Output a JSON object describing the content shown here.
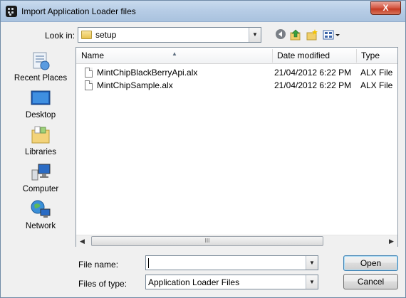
{
  "window": {
    "title": "Import Application Loader files",
    "close_label": "X"
  },
  "lookin": {
    "label": "Look in:",
    "value": "setup"
  },
  "places": [
    {
      "label": "Recent Places",
      "icon": "recent-places-icon"
    },
    {
      "label": "Desktop",
      "icon": "desktop-icon"
    },
    {
      "label": "Libraries",
      "icon": "libraries-icon"
    },
    {
      "label": "Computer",
      "icon": "computer-icon"
    },
    {
      "label": "Network",
      "icon": "network-icon"
    }
  ],
  "columns": {
    "name": "Name",
    "date": "Date modified",
    "type": "Type"
  },
  "files": [
    {
      "name": "MintChipBlackBerryApi.alx",
      "date": "21/04/2012 6:22 PM",
      "type": "ALX File"
    },
    {
      "name": "MintChipSample.alx",
      "date": "21/04/2012 6:22 PM",
      "type": "ALX File"
    }
  ],
  "filename": {
    "label": "File name:",
    "value": ""
  },
  "filetype": {
    "label": "Files of type:",
    "value": "Application Loader Files"
  },
  "buttons": {
    "open": "Open",
    "cancel": "Cancel"
  },
  "scrollbar": {
    "grip": "III"
  }
}
